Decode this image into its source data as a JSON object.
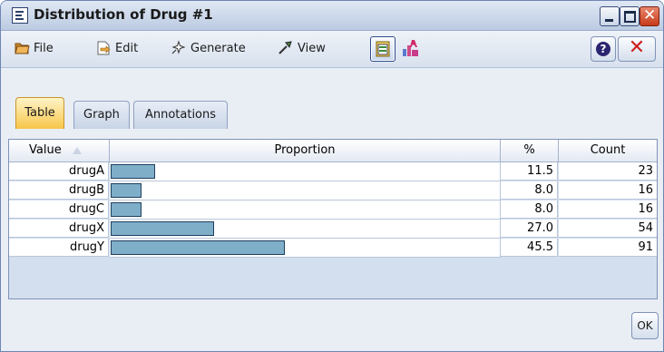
{
  "window": {
    "title": "Distribution of Drug #1",
    "controls": [
      "minimize",
      "maximize",
      "close"
    ]
  },
  "toolbar": {
    "menus": [
      {
        "label": "File",
        "icon": "file-icon"
      },
      {
        "label": "Edit",
        "icon": "edit-icon"
      },
      {
        "label": "Generate",
        "icon": "generate-icon"
      },
      {
        "label": "View",
        "icon": "view-icon"
      }
    ],
    "buttons": [
      "copy-table-icon",
      "chart-icon"
    ],
    "help_label": "?",
    "close_label": "✕"
  },
  "tabs": [
    {
      "label": "Table",
      "active": true
    },
    {
      "label": "Graph",
      "active": false
    },
    {
      "label": "Annotations",
      "active": false
    }
  ],
  "table": {
    "headers": {
      "value": "Value",
      "proportion": "Proportion",
      "percent": "%",
      "count": "Count"
    },
    "sort_indicator": "ascending",
    "rows": [
      {
        "value": "drugA",
        "percent": "11.5",
        "count": "23",
        "proportion": 0.115
      },
      {
        "value": "drugB",
        "percent": "8.0",
        "count": "16",
        "proportion": 0.08
      },
      {
        "value": "drugC",
        "percent": "8.0",
        "count": "16",
        "proportion": 0.08
      },
      {
        "value": "drugX",
        "percent": "27.0",
        "count": "54",
        "proportion": 0.27
      },
      {
        "value": "drugY",
        "percent": "45.5",
        "count": "91",
        "proportion": 0.455
      }
    ]
  },
  "footer": {
    "ok_label": "OK"
  },
  "colors": {
    "bar": "#7faec9",
    "active_tab": "#f7c64a",
    "titlebar": "#bccbe2"
  }
}
